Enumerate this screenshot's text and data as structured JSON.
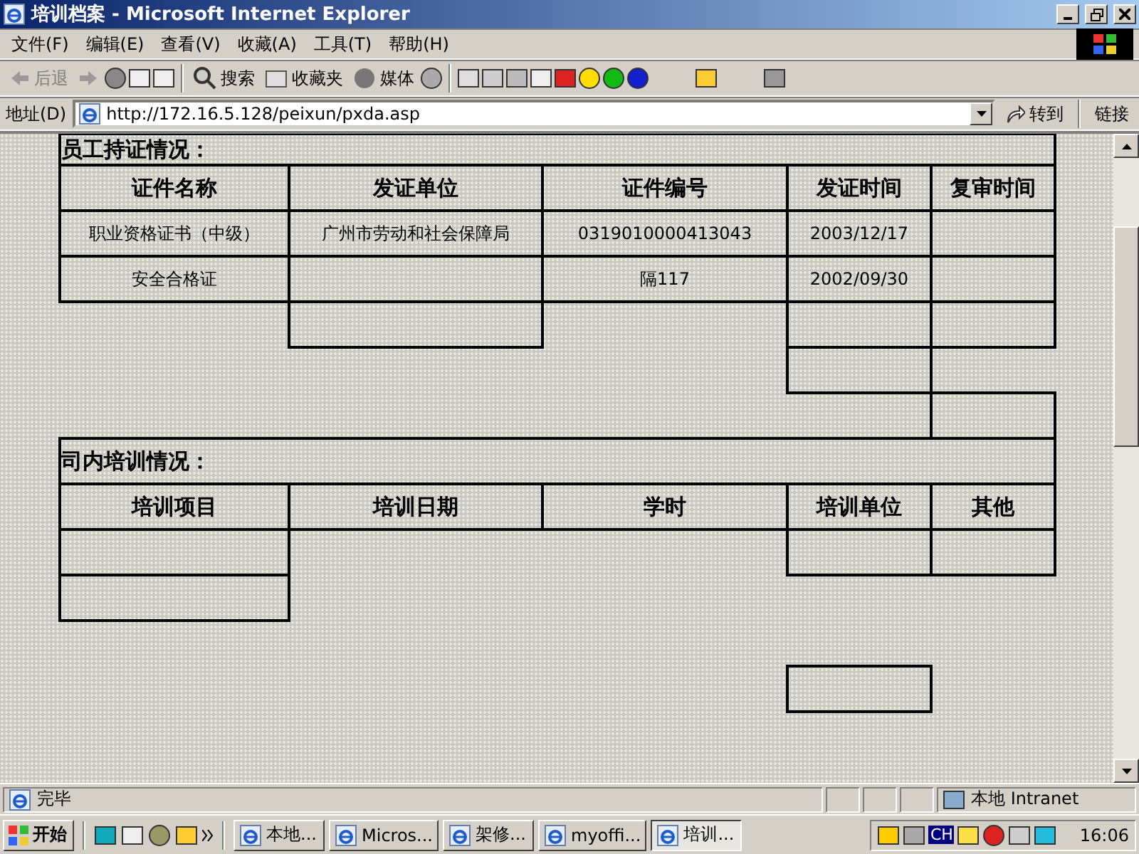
{
  "window": {
    "title": "培训档案 - Microsoft Internet Explorer"
  },
  "menu": [
    "文件(F)",
    "编辑(E)",
    "查看(V)",
    "收藏(A)",
    "工具(T)",
    "帮助(H)"
  ],
  "toolbar": {
    "back": {
      "label": "后退",
      "disabled": true
    },
    "search": "搜索",
    "favorites": "收藏夹",
    "media": "媒体"
  },
  "address": {
    "label": "地址(D)",
    "value": "http://172.16.5.128/peixun/pxda.asp",
    "go": "转到",
    "links": "链接"
  },
  "content": {
    "section1_title": "员工持证情况：",
    "cert_table": {
      "columns": [
        "证件名称",
        "发证单位",
        "证件编号",
        "发证时间",
        "复审时间"
      ],
      "rows": [
        {
          "name": "职业资格证书（中级）",
          "issuer": "广州市劳动和社会保障局",
          "number": "0319010000413043",
          "issue_date": "2003/12/17"
        },
        {
          "name": "安全合格证",
          "number": "隔117",
          "issue_date": "2002/09/30"
        }
      ]
    },
    "section2_title": "司内培训情况：",
    "training_table": {
      "columns": [
        "培训项目",
        "培训日期",
        "学时",
        "培训单位",
        "其他"
      ]
    }
  },
  "status_bar": {
    "text": "完毕",
    "zone": "本地 Intranet"
  },
  "taskbar": {
    "start": "开始",
    "tasks": [
      {
        "label": "本地...",
        "selected": false
      },
      {
        "label": "Micros...",
        "selected": false
      },
      {
        "label": "架修...",
        "selected": false
      },
      {
        "label": "myoffi...",
        "selected": false
      },
      {
        "label": "培训...",
        "selected": true
      }
    ],
    "ime": "CH",
    "clock": "16:06"
  }
}
